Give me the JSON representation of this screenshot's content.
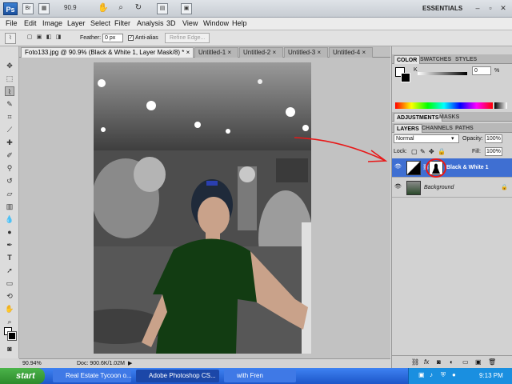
{
  "appbar": {
    "logo": "Ps",
    "bridge": "Br",
    "zoom": "90.9",
    "workspace": "ESSENTIALS"
  },
  "menu": [
    "File",
    "Edit",
    "Image",
    "Layer",
    "Select",
    "Filter",
    "Analysis",
    "3D",
    "View",
    "Window",
    "Help"
  ],
  "options": {
    "feather_label": "Feather:",
    "feather_value": "0 px",
    "antialias_label": "Anti-alias",
    "refine_edge": "Refine Edge..."
  },
  "tabs": [
    {
      "label": "Foto133.jpg @ 90.9% (Black & White 1, Layer Mask/8) *",
      "close": "×"
    },
    {
      "label": "Untitled-1",
      "close": "×"
    },
    {
      "label": "Untitled-2",
      "close": "×"
    },
    {
      "label": "Untitled-3",
      "close": "×"
    },
    {
      "label": "Untitled-4",
      "close": "×"
    }
  ],
  "status": {
    "zoom": "90.94%",
    "doc": "Doc: 900.6K/1.02M"
  },
  "color_panel": {
    "tabs": [
      "COLOR",
      "SWATCHES",
      "STYLES"
    ],
    "channel": "K",
    "value": "0",
    "unit": "%"
  },
  "adjust_panel": {
    "tabs": [
      "ADJUSTMENTS",
      "MASKS"
    ]
  },
  "layers_panel": {
    "tabs": [
      "LAYERS",
      "CHANNELS",
      "PATHS"
    ],
    "blend_mode": "Normal",
    "opacity_label": "Opacity:",
    "opacity_value": "100%",
    "lock_label": "Lock:",
    "fill_label": "Fill:",
    "fill_value": "100%",
    "layers": [
      {
        "name": "Black & White 1",
        "selected": true
      },
      {
        "name": "Background",
        "selected": false
      }
    ]
  },
  "taskbar": {
    "start": "start",
    "tasks": [
      "Real Estate Tycoon o...",
      "Adobe Photoshop CS...",
      "with Fren"
    ],
    "time": "9:13 PM"
  },
  "colors": {
    "selection": "#3f6fd2",
    "annotation": "#e81818",
    "taskbar": "#2a6ae0"
  }
}
